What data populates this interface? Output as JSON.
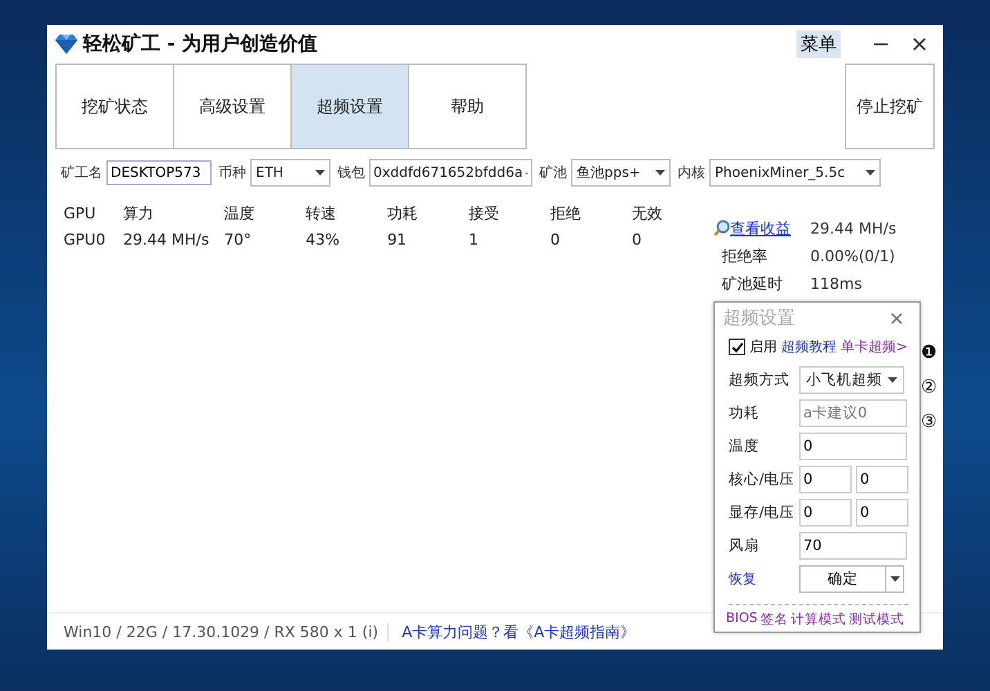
{
  "window": {
    "title": "轻松矿工 - 为用户创造价值",
    "menu": "菜单"
  },
  "tabs": [
    {
      "label": "挖矿状态",
      "selected": false
    },
    {
      "label": "高级设置",
      "selected": false
    },
    {
      "label": "超频设置",
      "selected": true
    },
    {
      "label": "帮助",
      "selected": false
    }
  ],
  "stop_button": "停止挖矿",
  "fields": [
    {
      "label": "矿工名",
      "kind": "text",
      "value": "DESKTOP573"
    },
    {
      "label": "币种",
      "kind": "select",
      "value": "ETH"
    },
    {
      "label": "钱包",
      "kind": "wallet",
      "value": "0xddfd671652bfdd6a"
    },
    {
      "label": "矿池",
      "kind": "select",
      "value": "鱼池pps+"
    },
    {
      "label": "内核",
      "kind": "select",
      "value": "PhoenixMiner_5.5c"
    }
  ],
  "table": {
    "columns": [
      "GPU",
      "算力",
      "温度",
      "转速",
      "功耗",
      "接受",
      "拒绝",
      "无效"
    ],
    "rows": [
      [
        "GPU0",
        "29.44 MH/s",
        "70°",
        "43%",
        "91",
        "1",
        "0",
        "0"
      ]
    ]
  },
  "stats": {
    "link": "查看收益",
    "value": "29.44 MH/s",
    "rows": [
      {
        "label": "拒绝率",
        "value": "0.00%(0/1)"
      },
      {
        "label": "矿池延时",
        "value": "118ms"
      }
    ]
  },
  "overclock_panel": {
    "title": "超频设置",
    "enabled": {
      "label": "启用",
      "checked": true
    },
    "links": [
      "超频教程",
      "单卡超频>"
    ],
    "method": {
      "label": "超频方式",
      "value": "小飞机超频"
    },
    "fields": [
      {
        "label": "功耗",
        "placeholder": "a卡建议0"
      },
      {
        "label": "温度",
        "values": [
          "0"
        ]
      },
      {
        "label": "核心/电压",
        "values": [
          "0",
          "0"
        ]
      },
      {
        "label": "显存/电压",
        "values": [
          "0",
          "0"
        ]
      },
      {
        "label": "风扇",
        "values": [
          "70"
        ]
      }
    ],
    "restore": "恢复",
    "confirm": "确定",
    "footer_links": [
      "BIOS",
      "签名",
      "计算模式",
      "测试模式"
    ]
  },
  "markers": [
    "❶",
    "②",
    "③"
  ],
  "status_bar": {
    "info": "Win10  / 22G / 17.30.1029 / RX 580 x 1 (i)",
    "link": "A卡算力问题？看《A卡超频指南》"
  }
}
